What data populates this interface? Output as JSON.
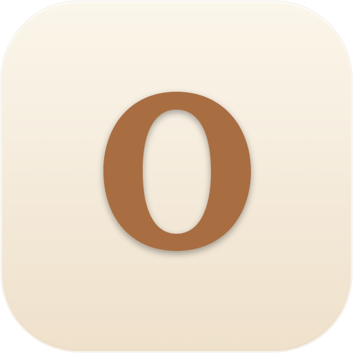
{
  "app_icon": {
    "letter": "O",
    "colors": {
      "background_top": "#FBF6EA",
      "background_bottom": "#EFE1CB",
      "glyph": "#A86E43",
      "glyph_shadow": "#6B4528"
    }
  }
}
